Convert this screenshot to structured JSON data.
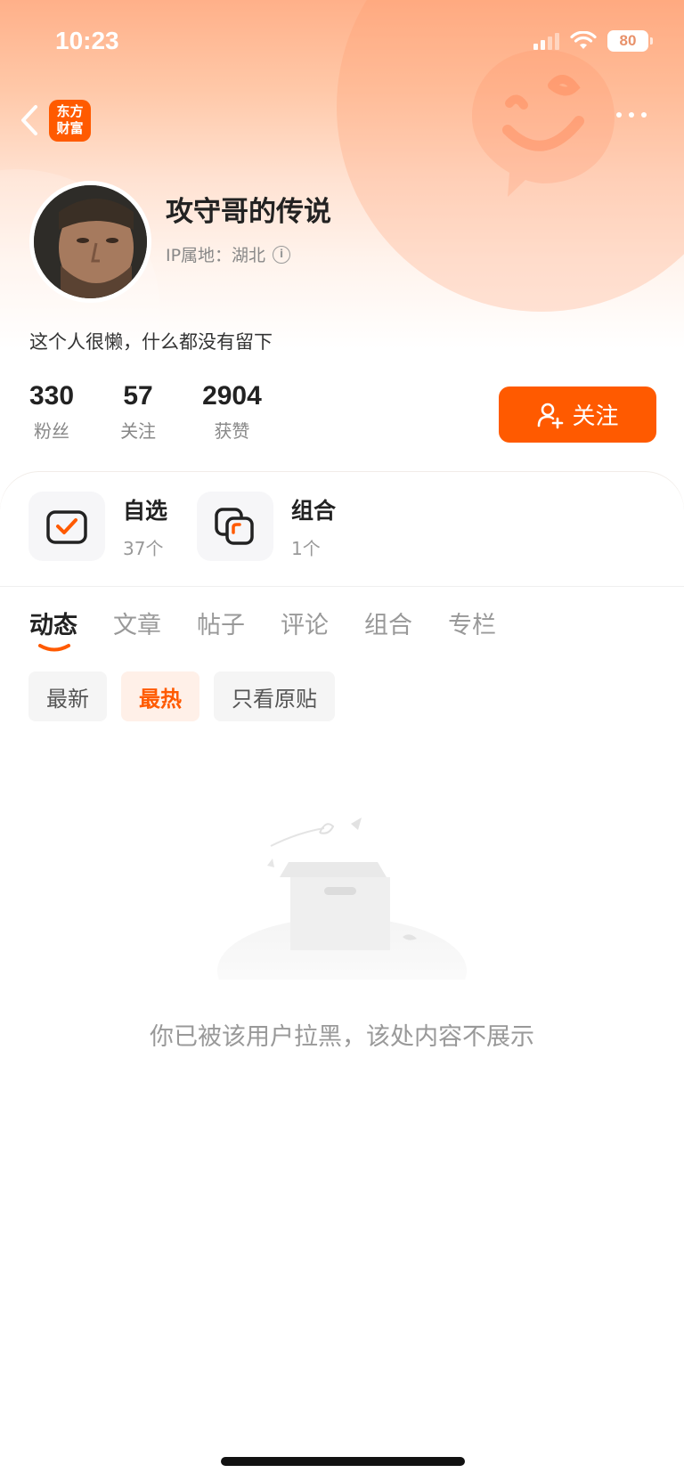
{
  "status_bar": {
    "time": "10:23",
    "battery": "80"
  },
  "nav": {
    "logo_line1": "东方",
    "logo_line2": "财富"
  },
  "profile": {
    "username": "攻守哥的传说",
    "ip_location": "IP属地：湖北",
    "bio": "这个人很懒，什么都没有留下",
    "follow_label": "关注",
    "stats": [
      {
        "value": "330",
        "label": "粉丝"
      },
      {
        "value": "57",
        "label": "关注"
      },
      {
        "value": "2904",
        "label": "获赞"
      }
    ]
  },
  "shortcuts": [
    {
      "title": "自选",
      "count": "37个"
    },
    {
      "title": "组合",
      "count": "1个"
    }
  ],
  "tabs": [
    "动态",
    "文章",
    "帖子",
    "评论",
    "组合",
    "专栏"
  ],
  "active_tab": "动态",
  "filters": [
    "最新",
    "最热",
    "只看原贴"
  ],
  "active_filter": "最热",
  "empty_message": "你已被该用户拉黑，该处内容不展示",
  "colors": {
    "accent": "#ff5a00",
    "accent_light": "#fff0e8"
  }
}
